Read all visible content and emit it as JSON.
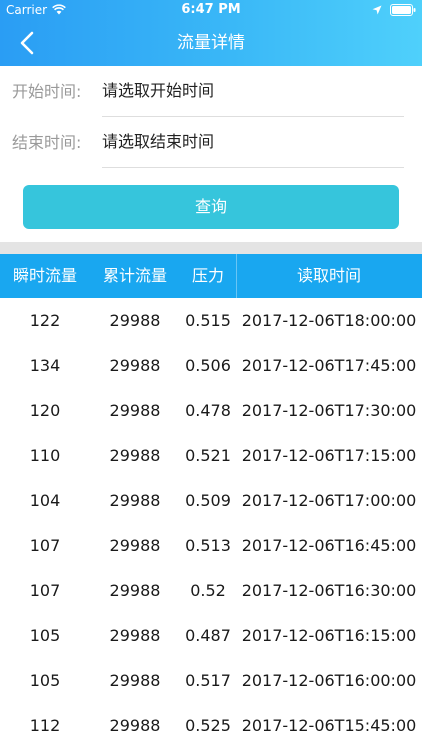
{
  "status_bar": {
    "carrier": "Carrier",
    "time": "6:47 PM"
  },
  "header": {
    "title": "流量详情"
  },
  "form": {
    "start_label": "开始时间:",
    "start_value": "请选取开始时间",
    "end_label": "结束时间:",
    "end_value": "请选取结束时间",
    "query_button": "查询"
  },
  "table": {
    "columns": [
      "瞬时流量",
      "累计流量",
      "压力",
      "读取时间"
    ],
    "rows": [
      [
        "122",
        "29988",
        "0.515",
        "2017-12-06T18:00:00"
      ],
      [
        "134",
        "29988",
        "0.506",
        "2017-12-06T17:45:00"
      ],
      [
        "120",
        "29988",
        "0.478",
        "2017-12-06T17:30:00"
      ],
      [
        "110",
        "29988",
        "0.521",
        "2017-12-06T17:15:00"
      ],
      [
        "104",
        "29988",
        "0.509",
        "2017-12-06T17:00:00"
      ],
      [
        "107",
        "29988",
        "0.513",
        "2017-12-06T16:45:00"
      ],
      [
        "107",
        "29988",
        "0.52",
        "2017-12-06T16:30:00"
      ],
      [
        "105",
        "29988",
        "0.487",
        "2017-12-06T16:15:00"
      ],
      [
        "105",
        "29988",
        "0.517",
        "2017-12-06T16:00:00"
      ],
      [
        "112",
        "29988",
        "0.525",
        "2017-12-06T15:45:00"
      ]
    ]
  },
  "colors": {
    "header_gradient_start": "#2a9df4",
    "header_gradient_end": "#4fd0fb",
    "query_button": "#36c5dc",
    "table_header": "#19a7f0"
  },
  "icons": {
    "back": "chevron-left-icon",
    "wifi": "wifi-icon",
    "location": "location-arrow-icon",
    "battery": "battery-icon"
  }
}
